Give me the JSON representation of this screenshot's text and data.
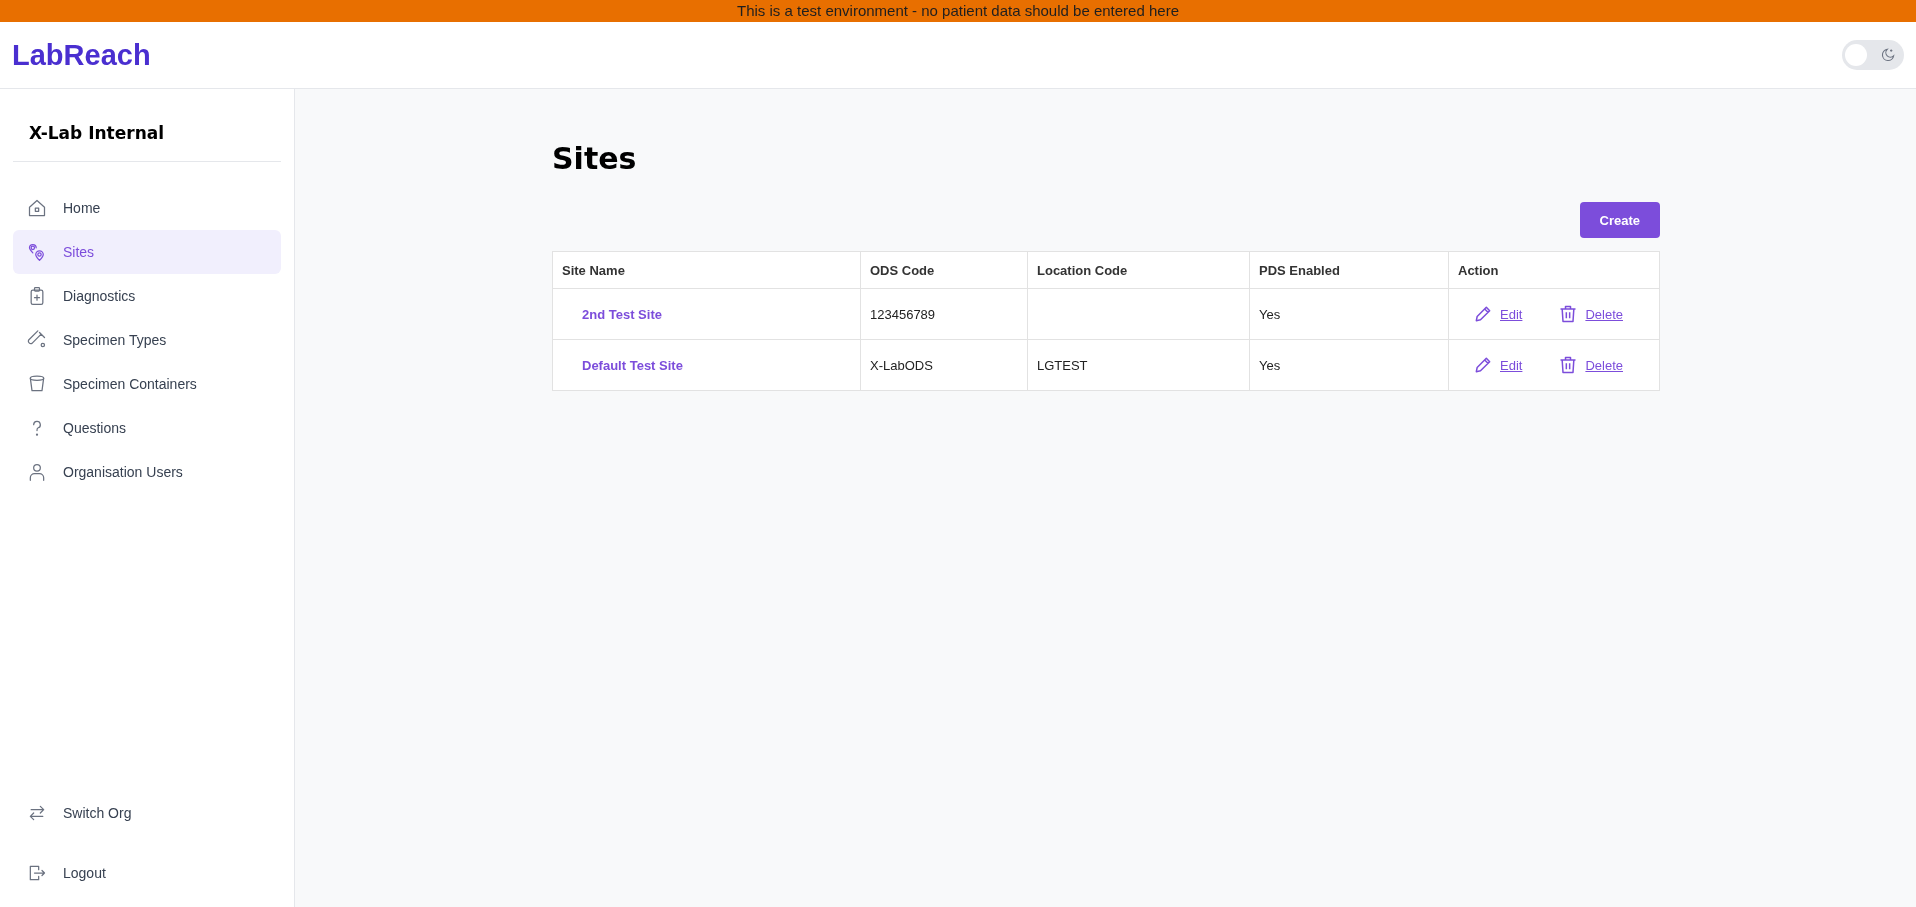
{
  "banner": "This is a test environment - no patient data should be entered here",
  "header": {
    "logo": "LabReach",
    "theme_toggle": {
      "on": false
    }
  },
  "sidebar": {
    "org": "X-Lab Internal",
    "items": [
      {
        "label": "Home",
        "kind": "home",
        "selected": false
      },
      {
        "label": "Sites",
        "kind": "sites",
        "selected": true
      },
      {
        "label": "Diagnostics",
        "kind": "diagnostics",
        "selected": false
      },
      {
        "label": "Specimen Types",
        "kind": "tube",
        "selected": false
      },
      {
        "label": "Specimen Containers",
        "kind": "container",
        "selected": false
      },
      {
        "label": "Questions",
        "kind": "question",
        "selected": false
      },
      {
        "label": "Organisation Users",
        "kind": "user",
        "selected": false
      }
    ],
    "bottom_items": [
      {
        "label": "Switch Org",
        "kind": "switch"
      },
      {
        "label": "Logout",
        "kind": "logout"
      }
    ]
  },
  "page": {
    "title": "Sites",
    "create_button": "Create",
    "table": {
      "columns": [
        "Site Name",
        "ODS Code",
        "Location Code",
        "PDS Enabled",
        "Action"
      ],
      "rows": [
        {
          "site_name": "2nd Test Site",
          "ods_code": "123456789",
          "location_code": "",
          "pds_enabled": "Yes",
          "edit": "Edit",
          "delete": "Delete"
        },
        {
          "site_name": "Default Test Site",
          "ods_code": "X-LabODS",
          "location_code": "LGTEST",
          "pds_enabled": "Yes",
          "edit": "Edit",
          "delete": "Delete"
        }
      ]
    }
  }
}
